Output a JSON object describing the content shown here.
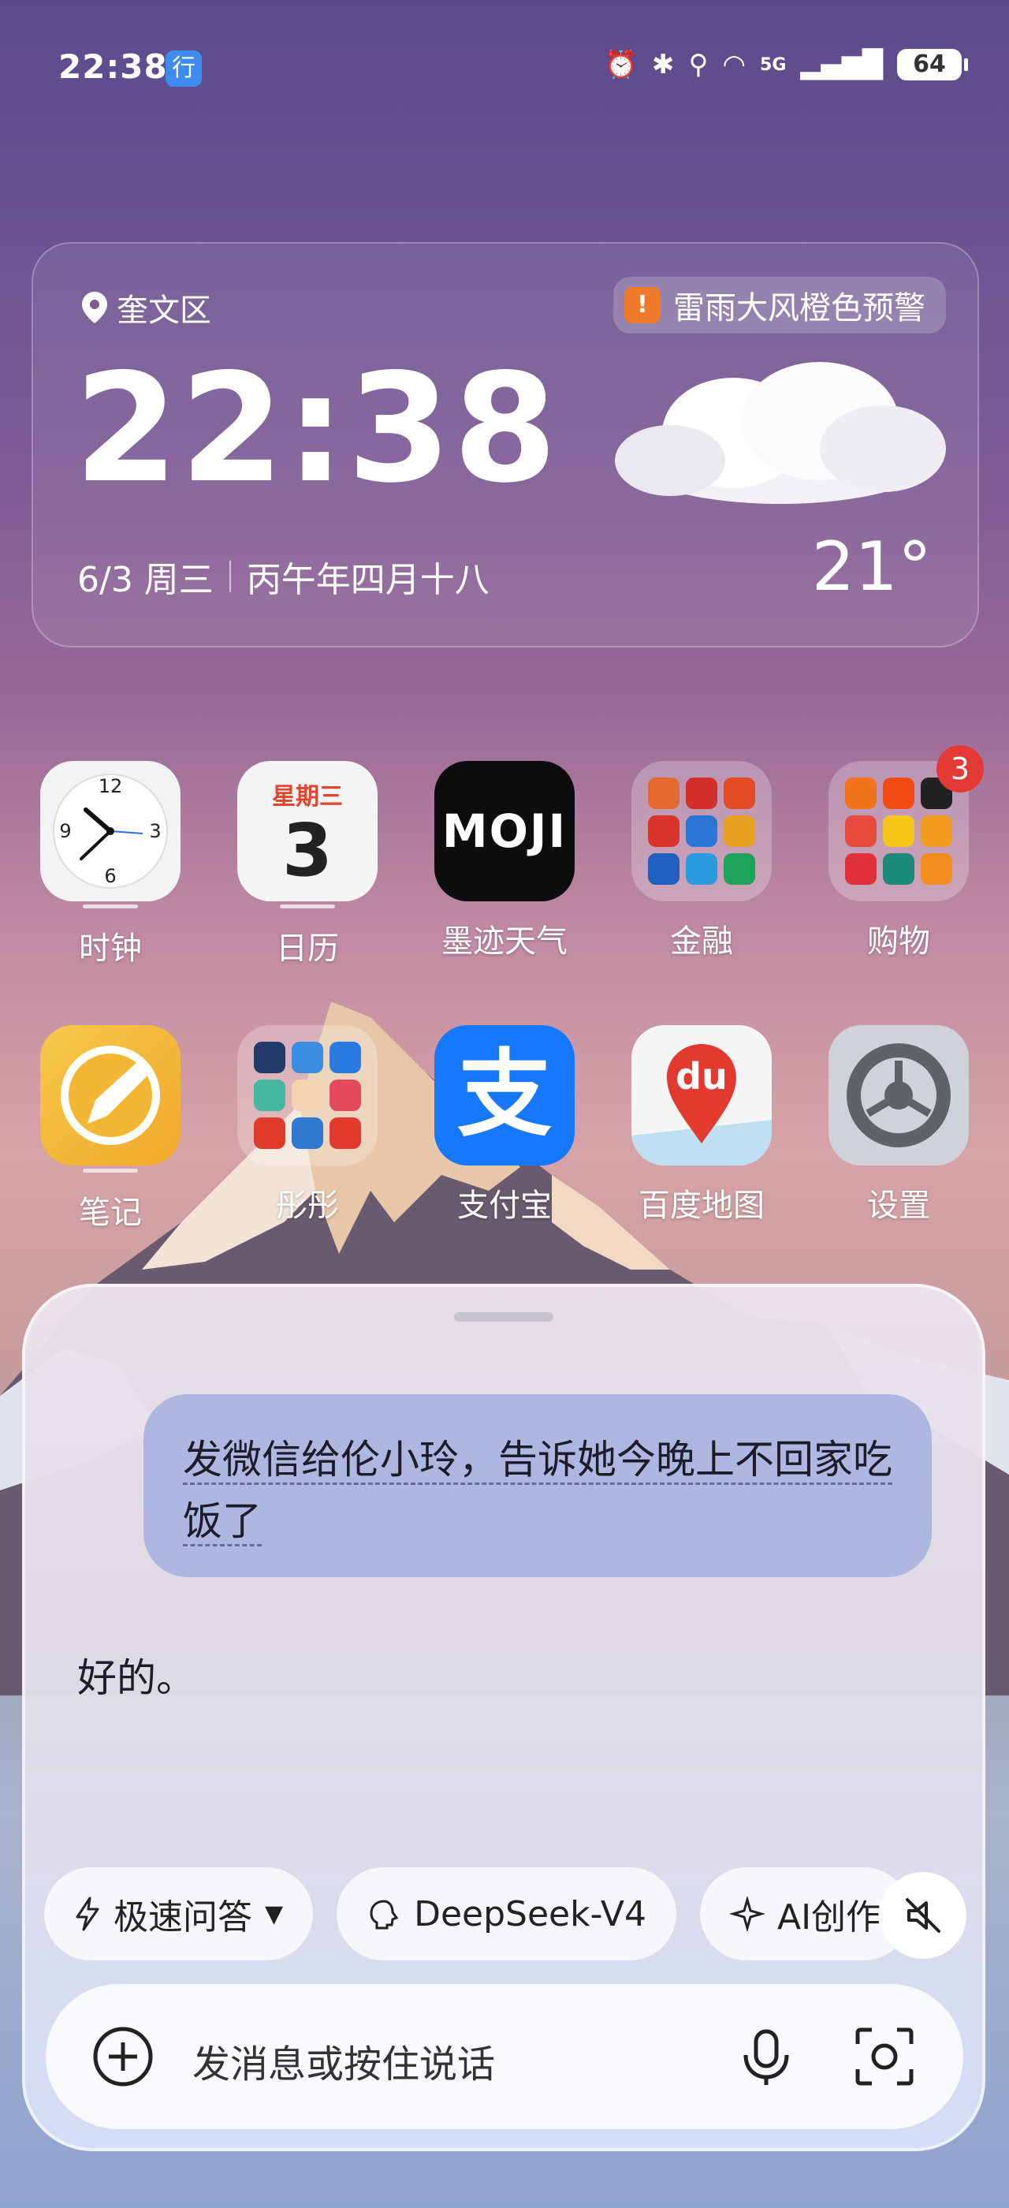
{
  "status_bar": {
    "time": "22:38",
    "xing_badge": "行",
    "battery": "64",
    "network": "5G"
  },
  "weather": {
    "location": "奎文区",
    "alert": "雷雨大风橙色预警",
    "time": "22:38",
    "date": "6/3 周三",
    "lunar": "丙午年四月十八",
    "temp": "21°"
  },
  "apps_row1": [
    {
      "label": "时钟"
    },
    {
      "label": "日历",
      "weekday": "星期三",
      "day": "3"
    },
    {
      "label": "墨迹天气",
      "logo": "MOJI"
    },
    {
      "label": "金融"
    },
    {
      "label": "购物",
      "badge": "3"
    }
  ],
  "apps_row2": [
    {
      "label": "笔记"
    },
    {
      "label": "彤彤"
    },
    {
      "label": "支付宝",
      "glyph": "支"
    },
    {
      "label": "百度地图",
      "glyph": "du"
    },
    {
      "label": "设置"
    }
  ],
  "assistant": {
    "user_message": "发微信给伦小玲，告诉她今晚上不回家吃饭了",
    "reply": "好的。",
    "chips": [
      {
        "label": "极速问答"
      },
      {
        "label": "DeepSeek-V4"
      },
      {
        "label": "AI创作"
      }
    ],
    "input_placeholder": "发消息或按住说话"
  }
}
